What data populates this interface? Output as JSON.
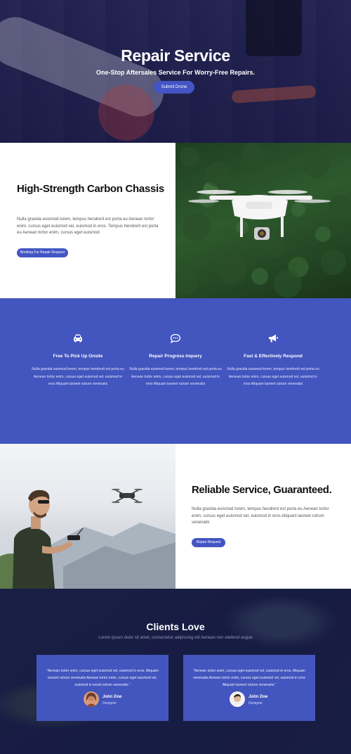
{
  "hero": {
    "title": "Repair Service",
    "subtitle": "One-Stop Aftersales Service For Worry-Free Repairs.",
    "button_label": "Submit Drone"
  },
  "chassis": {
    "title": "High-Strength Carbon Chassis",
    "body": "Nulla gravida euismod lorem, tempus hendrerit est porta eu Aenean tortor enim, cursus eget euismod vel, euismod in eros. Tempus hendrerit est porta eu Aenean tortor enim, cursus eget euismod",
    "button_label": "Booking For Repair Request"
  },
  "features": [
    {
      "icon": "car-icon",
      "title": "Free To Pick Up Onsite",
      "body": "Nulla gravida euismod lorem, tempus hendrerit est porta eu Aenean tortor enim, cursus eget euismod vel, euismod in eros Aliquam laoreet rutrum venenatis"
    },
    {
      "icon": "chat-icon",
      "title": "Repair Progress Inquery",
      "body": "Nulla gravida euismod lorem, tempus hendrerit est porta eu Aenean tortor enim, cursus eget euismod vel, euismod in eros Aliquam laoreet rutrum venenatis"
    },
    {
      "icon": "megaphone-icon",
      "title": "Fast & Effectively Respond",
      "body": "Nulla gravida euismod lorem, tempus hendrerit est porta eu Aenean tortor enim, cursus eget euismod vel, euismod in eros Aliquam laoreet rutrum venenatis"
    }
  ],
  "reliable": {
    "title": "Reliable Service, Guaranteed.",
    "body": "Nulla gravida euismod lorem, tempus hendrerit est porta eu Aenean tortor enim, cursus eget euismod vel, euismod in eros Aliquam laoreet rutrum venenatis",
    "button_label": "Repair Request"
  },
  "clients": {
    "title": "Clients Love",
    "subtitle": "Lorem ipsum dolor sit amet, consectetur adipiscing elit Aenean non eleifend augue",
    "testimonials": [
      {
        "quote": "\"Aenean tortor enim, cursus eget euismod vel, euismod in eros. Aliquam laoreet rutrum venenatis Aenean tortor enim, cursus eget euismod vel, euismod in erosli rutrum venenatis.\"",
        "name": "John Doe",
        "role": "Designer"
      },
      {
        "quote": "\"Aenean tortor enim, cursus eget euismod vel, euismod in eros. Aliquam venenatis Aenean tortor enim, cursus eget euismod vel, euismod in eros Aliquam laoreet rutrum venenatis.\"",
        "name": "John Doe",
        "role": "Designer"
      }
    ]
  },
  "colors": {
    "accent": "#4355c4",
    "section_blue": "#4355be",
    "hero_overlay": "#1e2260"
  }
}
